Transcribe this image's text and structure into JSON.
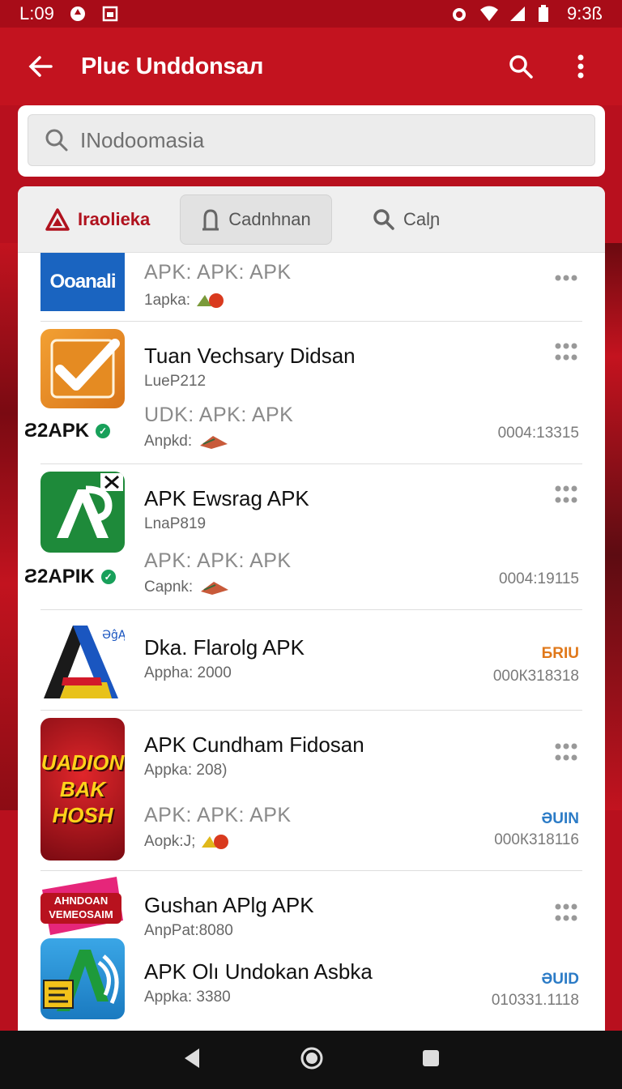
{
  "status": {
    "left_time": "L:09",
    "right_time": "9:3ß"
  },
  "appbar": {
    "title": "Pluє Unddonsaл"
  },
  "search": {
    "placeholder": "INodoomasia"
  },
  "tabs": [
    {
      "label": "Iraolieka"
    },
    {
      "label": "Cadnhnan"
    },
    {
      "label": "Calɲ"
    }
  ],
  "rows": [
    {
      "icon_text": "Ooanali",
      "apk": "APK:  APK:  APK",
      "meta": "1apka:"
    },
    {
      "name": "Tuan Vechsary Didsan",
      "sub": "LueP212",
      "tag": "Ƨ2APK",
      "apk": "UDK:  APK:  APK",
      "meta": "Anpkd:",
      "num": "0004:13315"
    },
    {
      "name": "APK Ewsrag APK",
      "sub": "LnaP819",
      "tag": "Ƨ2APIK",
      "apk": "APK:  APK:  APK",
      "meta": "Capnk:",
      "num": "0004:19115"
    },
    {
      "name": "Dka. Flarolg APK",
      "sub": "Appha: 2000",
      "badge": "БRIU",
      "num": "000К318318"
    },
    {
      "name": "APK Cundham Fidosan",
      "sub": "Appka: 208)",
      "icon_text": "UADION BAK HOSH",
      "apk": "APK:  APK:  APK",
      "meta": "Aopk:J;",
      "badge": "ƏUIN",
      "num": "000К318116"
    },
    {
      "name": "Gushan APlg APK",
      "sub": "AnpPat:8080",
      "icon_text": "AHNDOAN VEMEOSAIM"
    },
    {
      "name": "APK Olı Undokan Asbka",
      "sub": "Appka: 3380",
      "badge": "ƏUID",
      "num": "010331.1118"
    }
  ],
  "colors": {
    "brand": "#c3131f",
    "accent_orange": "#e0781a",
    "accent_blue": "#2b7bc6",
    "verified": "#18a05a"
  }
}
